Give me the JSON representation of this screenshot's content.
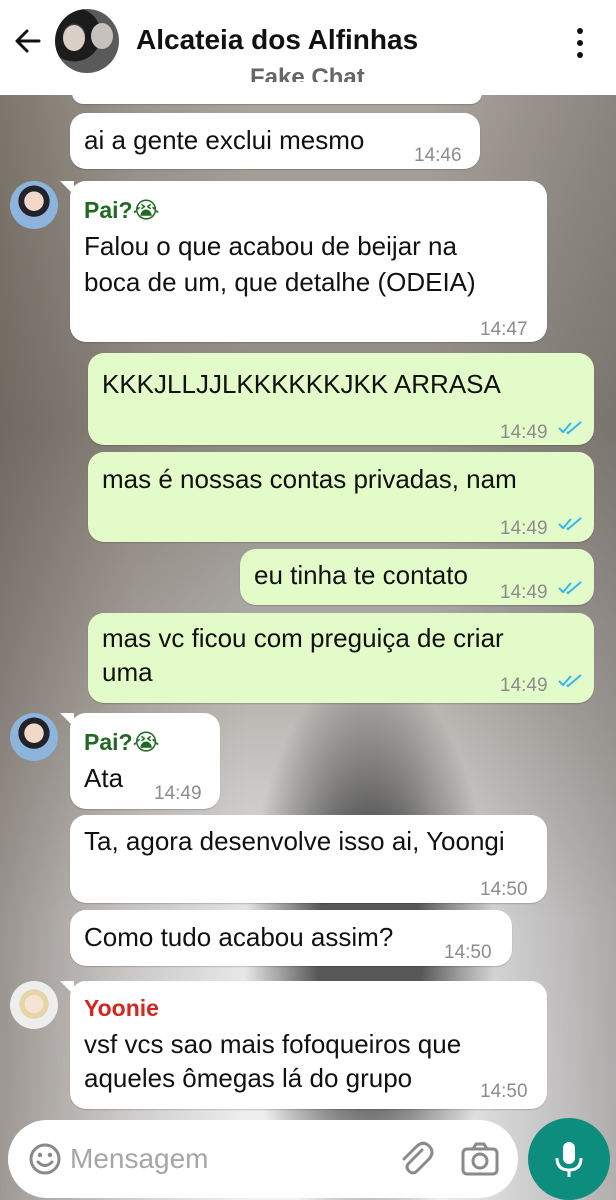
{
  "header": {
    "title": "Alcateia dos Alfinhas",
    "subtitle": "Fake Chat"
  },
  "messages": [
    {
      "type": "in",
      "text": "ai a gente exclui mesmo",
      "time": "14:46"
    },
    {
      "type": "in",
      "sender": "Pai?😭",
      "text_lines": [
        "Falou o que acabou de beijar na",
        "boca de um, que detalhe (ODEIA)"
      ],
      "time": "14:47"
    },
    {
      "type": "out",
      "text": "KKKJLLJJLKKKKKKJKK ARRASA",
      "time": "14:49",
      "status": "read"
    },
    {
      "type": "out",
      "text": "mas é nossas contas privadas, nam",
      "time": "14:49",
      "status": "read"
    },
    {
      "type": "out",
      "text": "eu tinha te contato",
      "time": "14:49",
      "status": "read"
    },
    {
      "type": "out",
      "text_lines": [
        "mas vc ficou com preguiça de criar",
        "uma"
      ],
      "time": "14:49",
      "status": "read"
    },
    {
      "type": "in",
      "sender": "Pai?😭",
      "text": "Ata",
      "time": "14:49"
    },
    {
      "type": "in",
      "text": "Ta, agora desenvolve isso ai, Yoongi",
      "time": "14:50"
    },
    {
      "type": "in",
      "text": "Como tudo acabou assim?",
      "time": "14:50"
    },
    {
      "type": "in",
      "sender": "Yoonie",
      "text_lines": [
        "vsf vcs sao mais fofoqueiros que",
        "aqueles ômegas lá do grupo"
      ],
      "time": "14:50"
    }
  ],
  "colors": {
    "header_bg": "#ffffff",
    "incoming_bubble": "#ffffff",
    "outgoing_bubble": "#e2fbc8",
    "sender_pai": "#1f6b22",
    "sender_yoonie": "#d3261e",
    "read_ticks": "#34b7f1",
    "mic_button": "#0c8d7d"
  },
  "composer": {
    "placeholder": "Mensagem"
  },
  "icons": {
    "back": "arrow-left-icon",
    "menu": "more-vert-icon",
    "emoji": "emoji-icon",
    "attach": "paperclip-icon",
    "camera": "camera-icon",
    "mic": "mic-icon"
  }
}
